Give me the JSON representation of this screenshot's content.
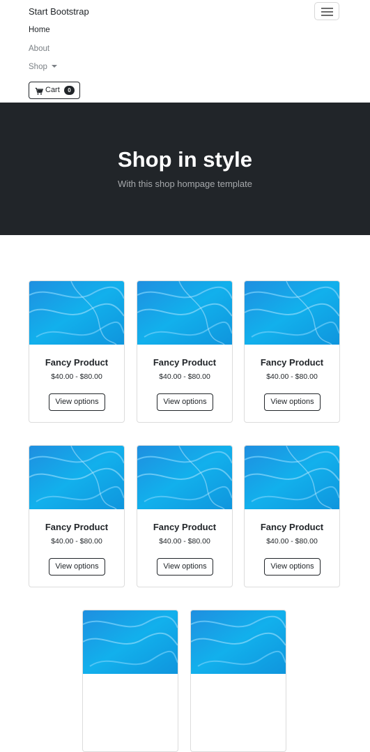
{
  "navbar": {
    "brand": "Start Bootstrap",
    "links": [
      "Home",
      "About",
      "Shop"
    ],
    "cart_label": "Cart",
    "cart_count": "0"
  },
  "hero": {
    "title": "Shop in style",
    "subtitle": "With this shop hompage template"
  },
  "products": [
    {
      "name": "Fancy Product",
      "price": "$40.00 - $80.00",
      "button": "View options"
    },
    {
      "name": "Fancy Product",
      "price": "$40.00 - $80.00",
      "button": "View options"
    },
    {
      "name": "Fancy Product",
      "price": "$40.00 - $80.00",
      "button": "View options"
    },
    {
      "name": "Fancy Product",
      "price": "$40.00 - $80.00",
      "button": "View options"
    },
    {
      "name": "Fancy Product",
      "price": "$40.00 - $80.00",
      "button": "View options"
    },
    {
      "name": "Fancy Product",
      "price": "$40.00 - $80.00",
      "button": "View options"
    },
    {
      "name": "",
      "price": "",
      "button": ""
    },
    {
      "name": "",
      "price": "",
      "button": ""
    }
  ],
  "colors": {
    "dark": "#212529",
    "muted": "#7b8085",
    "water": "#1ea0e6"
  }
}
